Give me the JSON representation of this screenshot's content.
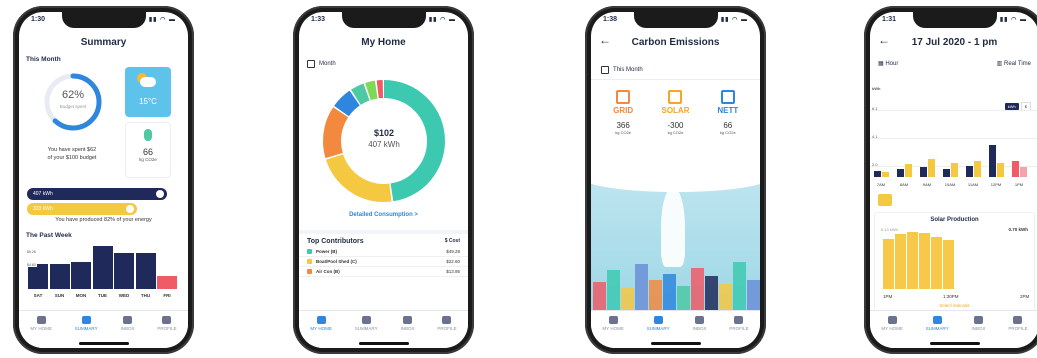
{
  "tabs": [
    "MY HOME",
    "SUMMARY",
    "INBOX",
    "PROFILE"
  ],
  "phone1": {
    "time": "1:30",
    "title": "Summary",
    "this_month": "This Month",
    "budget_pct": "62%",
    "budget_label": "Budget spent",
    "budget_fraction": 0.62,
    "spent_line1": "You have spent $62",
    "spent_line2": "of your $100 budget",
    "temperature": "15°C",
    "co2_value": "66",
    "co2_unit": "kg CO2e",
    "used_kwh": "407 kWh",
    "produced_kwh": "333 kWh",
    "produced_text": "You have produced 82% of your energy",
    "past_week": "The Past Week",
    "week_days": [
      "SAT",
      "SUN",
      "MON",
      "TUE",
      "WED",
      "THU",
      "FRI"
    ],
    "week_levels": [
      0.55,
      0.55,
      0.6,
      0.95,
      0.8,
      0.8,
      0.3
    ],
    "week_labels": [
      "$9.26",
      "$4.63"
    ]
  },
  "phone2": {
    "time": "1:33",
    "title": "My Home",
    "period": "Month",
    "amount": "$102",
    "kwh": "407 kWh",
    "detail_link": "Detailed Consumption >",
    "contrib_title": "Top Contributors",
    "cost_label": "$ Cost",
    "contributors": [
      {
        "name": "Power (B)",
        "cost": "$49.28",
        "color": "#3cc9b0"
      },
      {
        "name": "Boat/Pool Shed (C)",
        "cost": "$22.60",
        "color": "#f5c842"
      },
      {
        "name": "Air Con (B)",
        "cost": "$13.95",
        "color": "#f2893e"
      }
    ],
    "donut_segments": [
      {
        "value": 47,
        "color": "#3cc9b0"
      },
      {
        "value": 22,
        "color": "#f5c842"
      },
      {
        "value": 14,
        "color": "#f2893e"
      },
      {
        "value": 6,
        "color": "#2e86de"
      },
      {
        "value": 4,
        "color": "#4ec9a3"
      },
      {
        "value": 3,
        "color": "#7ed957"
      },
      {
        "value": 2,
        "color": "#ef5b67"
      }
    ]
  },
  "phone3": {
    "time": "1:38",
    "title": "Carbon Emissions",
    "period": "This Month",
    "cols": [
      {
        "label": "GRID",
        "value": "366",
        "unit": "kg CO2e",
        "color": "#f2893e"
      },
      {
        "label": "SOLAR",
        "value": "-300",
        "unit": "kg CO2e",
        "color": "#f5a623"
      },
      {
        "label": "NETT",
        "value": "66",
        "unit": "kg CO2e",
        "color": "#2e86de"
      }
    ]
  },
  "phone4": {
    "time": "1:31",
    "title": "17 Jul 2020 - 1 pm",
    "hour": "Hour",
    "realtime": "Real Time",
    "kwh_label": "kWh",
    "toggle_kwh": "kWh",
    "toggle_dollar": "$",
    "yticks": [
      "6.1",
      "4.1",
      "2.0"
    ],
    "x_labels": [
      "7AM",
      "8AM",
      "9AM",
      "10AM",
      "11AM",
      "12PM",
      "1PM"
    ],
    "solar_title": "Solar Production",
    "solar_left": "0.13 kWh",
    "solar_right": "0.70 kWh",
    "solar_x": [
      "1PM",
      "1:30PM",
      "2PM"
    ],
    "select_intervals": "Select intervals",
    "solar_levels": [
      0.72,
      0.78,
      0.82,
      0.8,
      0.74,
      0.7
    ]
  }
}
